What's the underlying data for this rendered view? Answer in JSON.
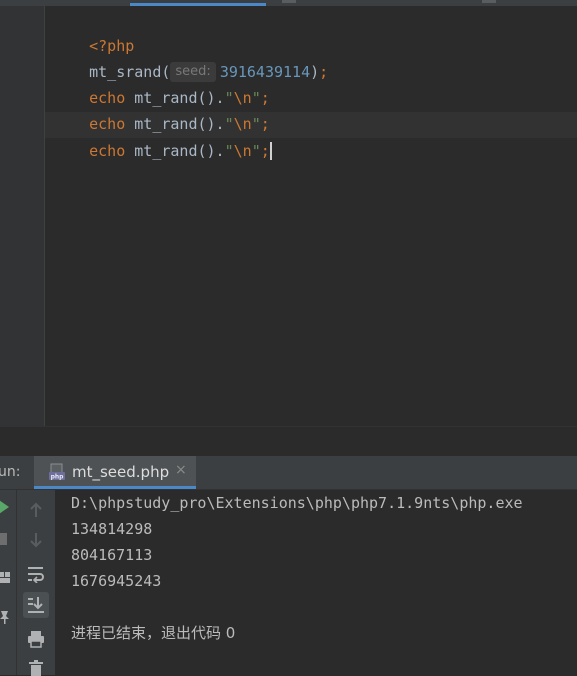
{
  "editor": {
    "lines": [
      {
        "open_tag": "<?php"
      },
      {
        "func": "mt_srand(",
        "hint": "seed:",
        "seed": "3916439114",
        "close": ")",
        "semi": ";"
      },
      {
        "kw": "echo",
        "call": " mt_rand().",
        "str_open": "\"",
        "esc": "\\n",
        "str_close": "\"",
        "semi": ";"
      },
      {
        "kw": "echo",
        "call": " mt_rand().",
        "str_open": "\"",
        "esc": "\\n",
        "str_close": "\"",
        "semi": ";"
      },
      {
        "kw": "echo",
        "call": " mt_rand().",
        "str_open": "\"",
        "esc": "\\n",
        "str_close": "\"",
        "semi": ";"
      }
    ]
  },
  "run_panel": {
    "label": "un:",
    "tab": {
      "title": "mt_seed.php",
      "close": "×"
    },
    "output": [
      "D:\\phpstudy_pro\\Extensions\\php\\php7.1.9nts\\php.exe",
      "134814298",
      "804167113",
      "1676945243",
      "",
      "进程已结束，退出代码 0"
    ]
  },
  "colors": {
    "background": "#2b2b2b",
    "keyword": "#cc7832",
    "number": "#6897bb",
    "string": "#6a8759",
    "text": "#a9b7c6",
    "accent": "#4a88c7"
  },
  "icons": {
    "run": "play-icon",
    "stop": "stop-icon",
    "scroll_up": "arrow-up-icon",
    "scroll_down": "arrow-down-icon",
    "wrap": "soft-wrap-icon",
    "scroll_to_end": "scroll-to-end-icon",
    "print": "print-icon",
    "delete": "trash-icon",
    "layout": "layout-icon",
    "pin": "pin-icon",
    "php_file": "php-file-icon"
  }
}
